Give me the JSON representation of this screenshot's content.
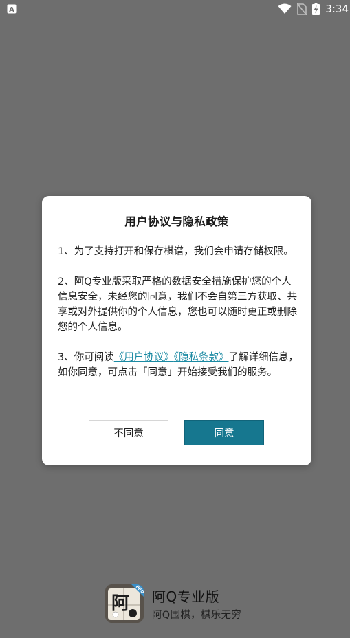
{
  "status_bar": {
    "left_icon": "a-notification-icon",
    "icons": [
      "wifi-icon",
      "no-sim-icon",
      "battery-charging-icon"
    ],
    "time": "3:34"
  },
  "dialog": {
    "title": "用户协议与隐私政策",
    "para1": "1、为了支持打开和保存棋谱，我们会申请存储权限。",
    "para2": "2、阿Q专业版采取严格的数据安全措施保护您的个人信息安全，未经您的同意，我们不会自第三方获取、共享或对外提供你的个人信息，您也可以随时更正或删除您的个人信息。",
    "para3_prefix": "3、你可阅读",
    "user_agreement_link": "《用户协议》",
    "privacy_link": "《隐私条款》",
    "para3_suffix": "了解详细信息，如你同意，可点击「同意」开始接受我们的服务。",
    "disagree_label": "不同意",
    "agree_label": "同意",
    "accent_color": "#16778f"
  },
  "brand": {
    "name": "阿Q专业版",
    "slogan": "阿Q围棋，棋乐无穷",
    "logo_char": "阿",
    "logo_badge": "PRO"
  }
}
